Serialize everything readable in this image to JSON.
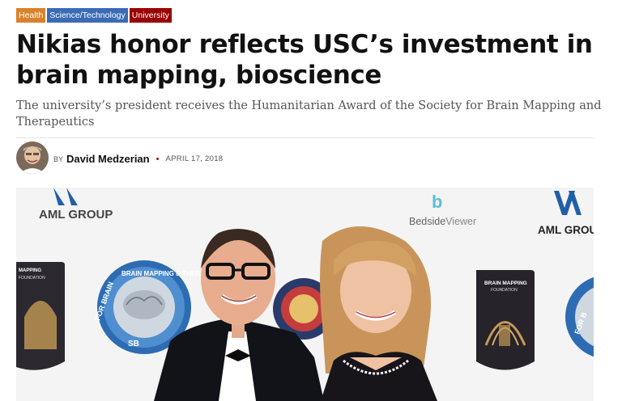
{
  "tags": [
    {
      "label": "Health",
      "color": "#d9822b"
    },
    {
      "label": "Science/Technology",
      "color": "#3a6cb5"
    },
    {
      "label": "University",
      "color": "#990000"
    }
  ],
  "article": {
    "headline": "Nikias honor reflects USC’s investment in brain mapping, bioscience",
    "subheadline": "The university’s president receives the Humanitarian Award of the Society for Brain Mapping and Therapeutics",
    "byline_prefix": "BY",
    "author": "David Medzerian",
    "date": "APRIL 17, 2018"
  },
  "photo": {
    "backdrop_logos": {
      "aml_group": "AML GROUP",
      "aml_group_cut": "AML GROU",
      "bedside_prefix": "Bedside",
      "bedside_suffix": "Viewer",
      "bedside_mark": "b",
      "bmf_line1": "BRAIN MAPPING",
      "bmf_line2": "FOUNDATION",
      "seal_text": "BRAIN MAPPING & THERAPEUTICS",
      "seal_left_text": "FOR BRAIN",
      "mapping_left": "MAPPING",
      "mapping_left2": "FOUNDATION",
      "seal_short": "SB",
      "right_seal": "FOR B"
    }
  }
}
